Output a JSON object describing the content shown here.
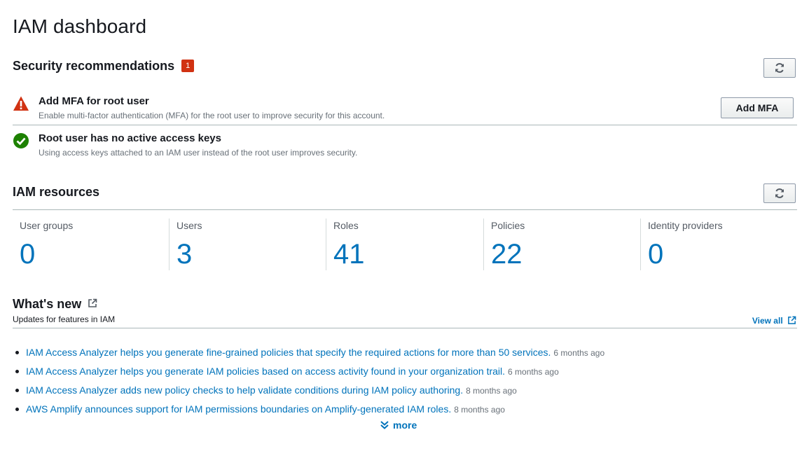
{
  "page": {
    "title": "IAM dashboard"
  },
  "security": {
    "heading": "Security recommendations",
    "badge_count": "1",
    "refresh_icon": "refresh-icon",
    "items": [
      {
        "status": "warning",
        "title": "Add MFA for root user",
        "description": "Enable multi-factor authentication (MFA) for the root user to improve security for this account.",
        "action_label": "Add MFA"
      },
      {
        "status": "success",
        "title": "Root user has no active access keys",
        "description": "Using access keys attached to an IAM user instead of the root user improves security."
      }
    ]
  },
  "resources": {
    "heading": "IAM resources",
    "items": [
      {
        "label": "User groups",
        "count": "0"
      },
      {
        "label": "Users",
        "count": "3"
      },
      {
        "label": "Roles",
        "count": "41"
      },
      {
        "label": "Policies",
        "count": "22"
      },
      {
        "label": "Identity providers",
        "count": "0"
      }
    ]
  },
  "whats_new": {
    "heading": "What's new",
    "subheading": "Updates for features in IAM",
    "view_all_label": "View all",
    "items": [
      {
        "text": "IAM Access Analyzer helps you generate fine-grained policies that specify the required actions for more than 50 services.",
        "age": "6 months ago"
      },
      {
        "text": "IAM Access Analyzer helps you generate IAM policies based on access activity found in your organization trail.",
        "age": "6 months ago"
      },
      {
        "text": "IAM Access Analyzer adds new policy checks to help validate conditions during IAM policy authoring.",
        "age": "8 months ago"
      },
      {
        "text": "AWS Amplify announces support for IAM permissions boundaries on Amplify-generated IAM roles.",
        "age": "8 months ago"
      }
    ],
    "more_label": "more"
  },
  "colors": {
    "link": "#0073bb",
    "warning": "#d13212",
    "success": "#1d8102",
    "text": "#16191f",
    "muted": "#687078"
  }
}
